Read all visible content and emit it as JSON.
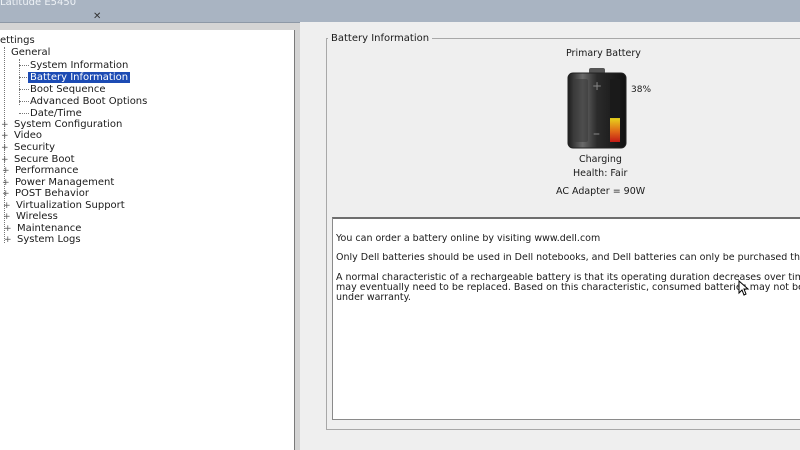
{
  "window": {
    "title": "Latitude E5450"
  },
  "tree": {
    "root": "ettings",
    "general": {
      "label": "General",
      "children": [
        "System Information",
        "Battery Information",
        "Boot Sequence",
        "Advanced Boot Options",
        "Date/Time"
      ]
    },
    "items": [
      "System Configuration",
      "Video",
      "Security",
      "Secure Boot",
      "Performance",
      "Power Management",
      "POST Behavior",
      "Virtualization Support",
      "Wireless",
      "Maintenance",
      "System Logs"
    ],
    "selected": "Battery Information"
  },
  "panel": {
    "title": "Battery Information",
    "battery_label": "Primary Battery",
    "charge_percent": 38,
    "charge_text": "38%",
    "status": "Charging",
    "health": "Health: Fair",
    "adapter": "AC Adapter = 90W"
  },
  "info": {
    "line1": "You can order a battery online by visiting www.dell.com",
    "line2": "Only Dell batteries should be used in Dell notebooks, and Dell batteries can only be purchased throu",
    "line3a": "A normal characteristic of a rechargeable battery is that its operating duration decreases over time.  Th",
    "line3b": "may eventually need to be replaced.  Based on this characteristic, consumed batteries may not be co",
    "line3c": "under warranty."
  },
  "colors": {
    "selection": "#1c4bb4",
    "battery_fill_red": "#c8201a",
    "battery_fill_yellow": "#e0d21a",
    "battery_body": "#2a2a2a"
  }
}
